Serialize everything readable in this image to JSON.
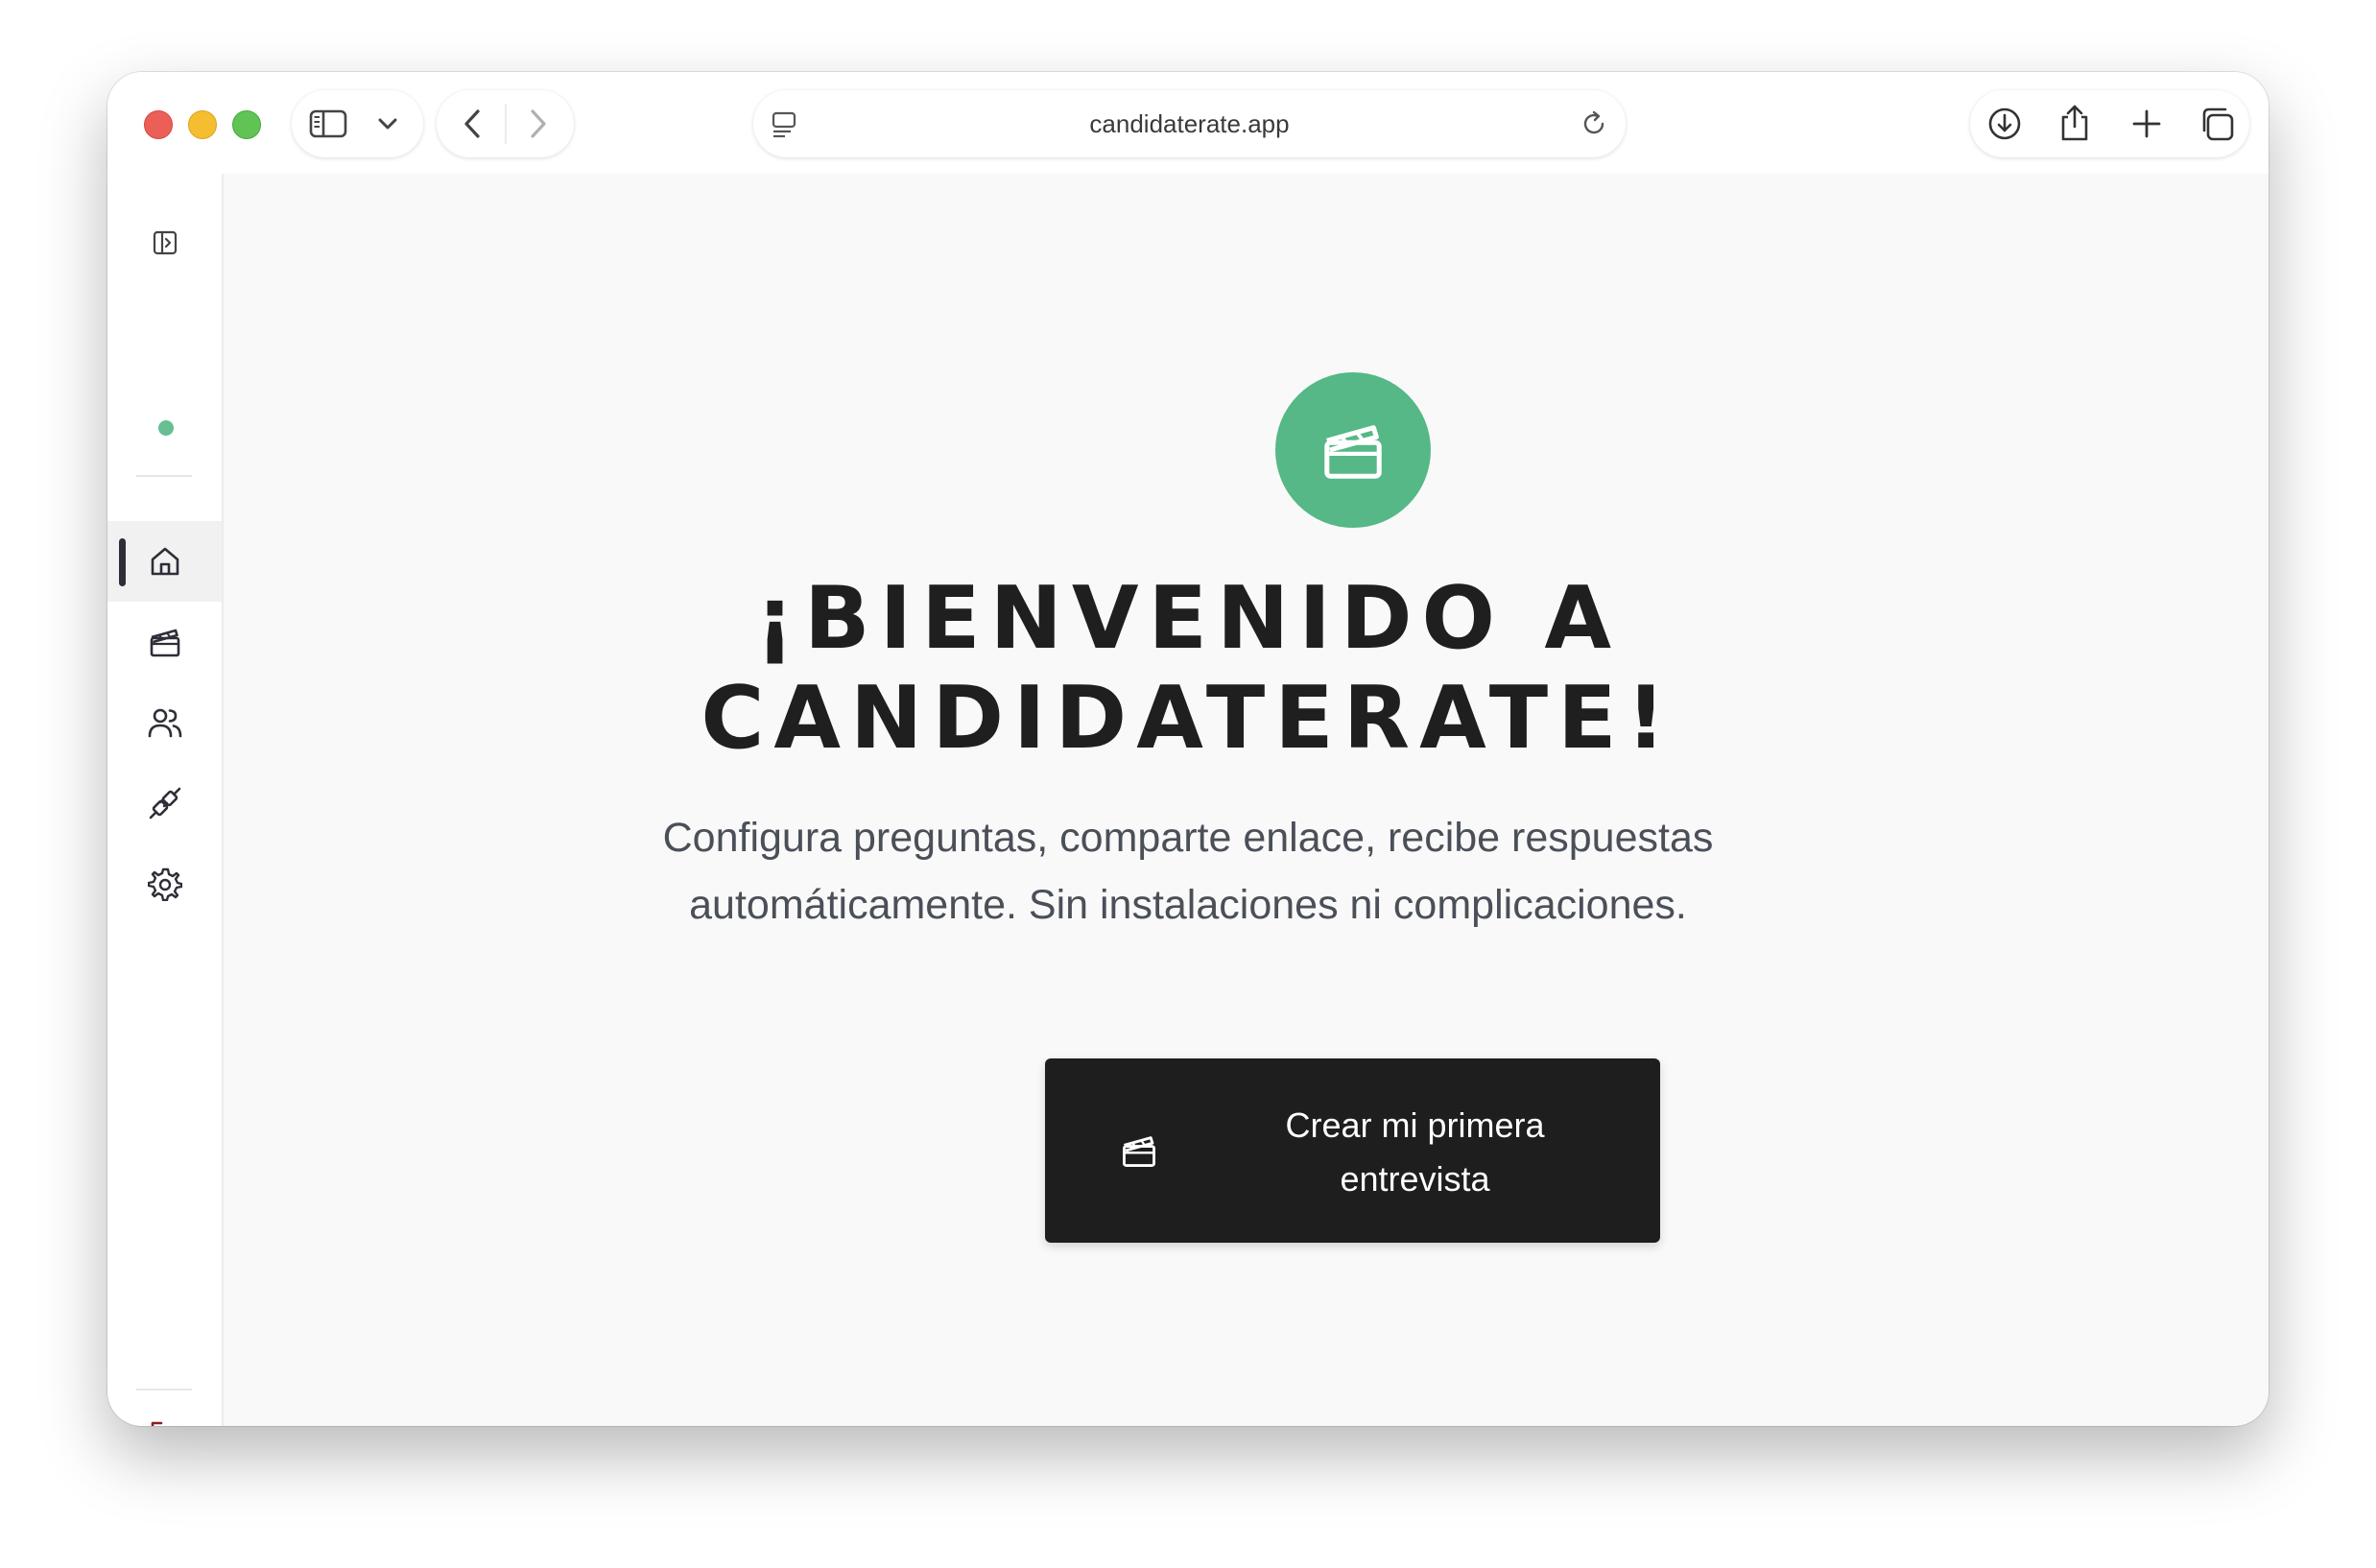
{
  "browser": {
    "url": "candidaterate.app"
  },
  "sidebar": {
    "items": [
      {
        "name": "home",
        "icon": "home-icon",
        "active": true
      },
      {
        "name": "interviews",
        "icon": "clapperboard-icon",
        "active": false
      },
      {
        "name": "candidates",
        "icon": "users-icon",
        "active": false
      },
      {
        "name": "integrations",
        "icon": "plug-icon",
        "active": false
      },
      {
        "name": "settings",
        "icon": "gear-icon",
        "active": false
      }
    ],
    "status_color": "#56b886",
    "logout_icon": "logout-icon",
    "logout_color": "#8b1e1e"
  },
  "main": {
    "hero_icon": "clapperboard-icon",
    "hero_color": "#55b886",
    "title_line1": "¡BIENVENIDO A",
    "title_line2": "CANDIDATERATE!",
    "subtitle_line1": "Configura preguntas, comparte enlace, recibe respuestas",
    "subtitle_line2": "automáticamente. Sin instalaciones ni complicaciones.",
    "cta_line1": "Crear mi primera",
    "cta_line2": "entrevista",
    "cta_icon": "clapperboard-icon"
  }
}
